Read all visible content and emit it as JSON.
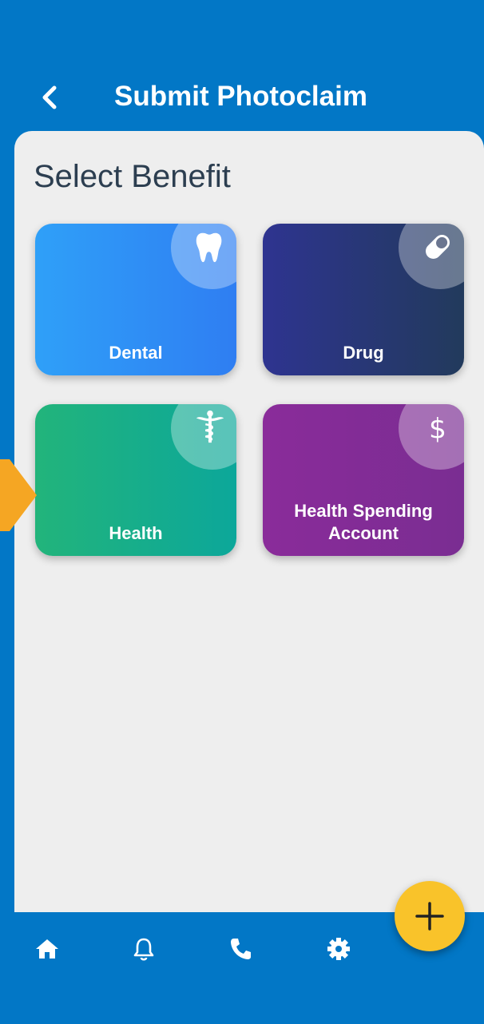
{
  "header": {
    "title": "Submit Photoclaim"
  },
  "main": {
    "section_title": "Select Benefit",
    "cards": [
      {
        "label": "Dental",
        "icon": "tooth-icon"
      },
      {
        "label": "Drug",
        "icon": "pill-icon"
      },
      {
        "label": "Health",
        "icon": "caduceus-icon"
      },
      {
        "label": "Health Spending Account",
        "icon": "dollar-icon"
      }
    ]
  },
  "bottom_nav": {
    "items": [
      "home-icon",
      "bell-icon",
      "phone-icon",
      "gear-icon"
    ],
    "fab_icon": "plus-icon"
  },
  "colors": {
    "primary": "#0277c6",
    "fab": "#f9c32a",
    "pointer": "#f5a623"
  }
}
